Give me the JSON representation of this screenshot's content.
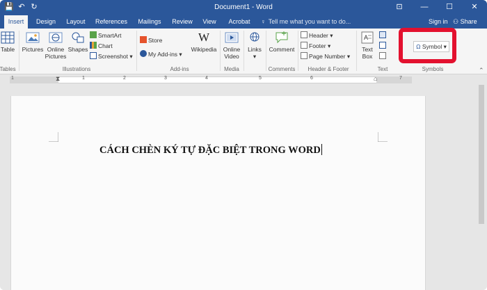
{
  "window": {
    "title": "Document1 - Word",
    "controls": {
      "ribbon_display": "⊡",
      "minimize": "—",
      "maximize": "☐",
      "close": "✕"
    }
  },
  "qat": {
    "save": "💾",
    "undo": "↶",
    "redo": "↻"
  },
  "tabs": [
    {
      "label": "Insert",
      "active": true
    },
    {
      "label": "Design"
    },
    {
      "label": "Layout"
    },
    {
      "label": "References"
    },
    {
      "label": "Mailings"
    },
    {
      "label": "Review"
    },
    {
      "label": "View"
    },
    {
      "label": "Acrobat"
    }
  ],
  "tell_me": {
    "placeholder": "Tell me what you want to do...",
    "icon": "lightbulb-icon"
  },
  "account": {
    "sign_in": "Sign in",
    "share": "Share"
  },
  "ribbon": {
    "tables": {
      "label": "Tables",
      "table": "Table"
    },
    "illustrations": {
      "label": "Illustrations",
      "pictures": "Pictures",
      "online_pictures_1": "Online",
      "online_pictures_2": "Pictures",
      "shapes": "Shapes",
      "smartart": "SmartArt",
      "chart": "Chart",
      "screenshot": "Screenshot"
    },
    "addins": {
      "label": "Add-ins",
      "store": "Store",
      "my_addins": "My Add-ins",
      "wikipedia": "Wikipedia"
    },
    "media": {
      "label": "Media",
      "online_video_1": "Online",
      "online_video_2": "Video"
    },
    "links": {
      "label": "Links"
    },
    "comments": {
      "label": "Comments",
      "comment": "Comment"
    },
    "header_footer": {
      "label": "Header & Footer",
      "header": "Header",
      "footer": "Footer",
      "page_number": "Page Number"
    },
    "text": {
      "label": "Text",
      "text_box_1": "Text",
      "text_box_2": "Box"
    },
    "symbols": {
      "label": "Symbols",
      "symbol": "Symbol",
      "symbol_glyph": "Ω"
    }
  },
  "ruler": {
    "numbers": [
      "1",
      "1",
      "2",
      "3",
      "4",
      "5",
      "6",
      "7"
    ]
  },
  "document": {
    "heading": "CÁCH CHÈN KÝ TỰ ĐẶC BIỆT TRONG WORD"
  },
  "colors": {
    "word_blue": "#2b579a",
    "highlight_red": "#e3112f"
  }
}
